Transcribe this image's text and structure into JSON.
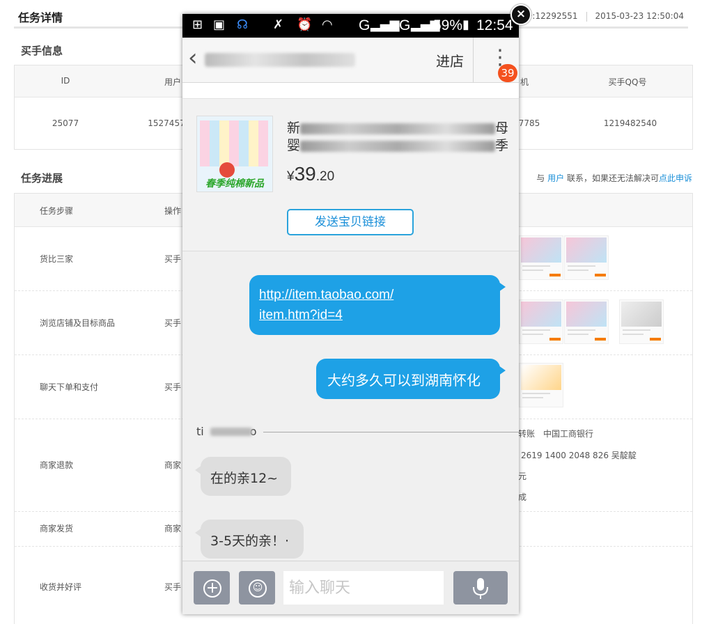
{
  "page": {
    "title": "任务详情",
    "order_no": "编号:12292551",
    "datetime": "2015-03-23 12:50:04"
  },
  "buyer": {
    "section_title": "买手信息",
    "headers": [
      "ID",
      "用户",
      "机",
      "买手QQ号"
    ],
    "row": [
      "25077",
      "1527457",
      "7785",
      "1219482540"
    ]
  },
  "progress": {
    "section_title": "任务进展",
    "note_prefix": "与",
    "note_user_link": "用户",
    "note_middle": "联系，如果还无法解决可",
    "note_appeal_link": "点此申诉",
    "headers": [
      "任务步骤",
      "操作"
    ],
    "steps": [
      {
        "step": "货比三家",
        "op": "买手"
      },
      {
        "step": "浏览店铺及目标商品",
        "op": "买手"
      },
      {
        "step": "聊天下单和支付",
        "op": "买手"
      },
      {
        "step": "商家退款",
        "op": "商家"
      },
      {
        "step": "商家发货",
        "op": "商家"
      },
      {
        "step": "收货并好评",
        "op": "买手"
      }
    ],
    "refund_details": [
      "转账　中国工商银行",
      "2619 1400 2048 826 吴靛靛",
      "元",
      "成"
    ]
  },
  "phone": {
    "status": {
      "battery": "59%",
      "time": "12:54",
      "signal1": "G",
      "signal2": "G"
    },
    "nav": {
      "enter_store": "进店",
      "badge": "39"
    },
    "product": {
      "title_start_1": "新",
      "title_end_1": "母",
      "title_start_2": "婴",
      "title_end_2": "季",
      "promo": "春季纯棉新品",
      "price_symbol": "¥",
      "price_int": "39",
      "price_dec": ".20",
      "send_link_button": "发送宝贝链接"
    },
    "messages": {
      "link_line1": "http://item.taobao.com/",
      "link_line2": "item.htm?id=4",
      "question": "大约多久可以到湖南怀化",
      "sender_prefix": "ti",
      "sender_suffix": "o",
      "reply1": "在的亲12~",
      "reply2": "3-5天的亲！·"
    },
    "input": {
      "placeholder": "输入聊天"
    }
  },
  "icons": [
    "plus-icon",
    "image-icon",
    "headset-icon",
    "mute-icon",
    "alarm-icon",
    "wifi-icon",
    "signal-icon",
    "battery-icon",
    "back-icon",
    "more-icon",
    "close-icon",
    "emoji-icon",
    "mic-icon"
  ]
}
